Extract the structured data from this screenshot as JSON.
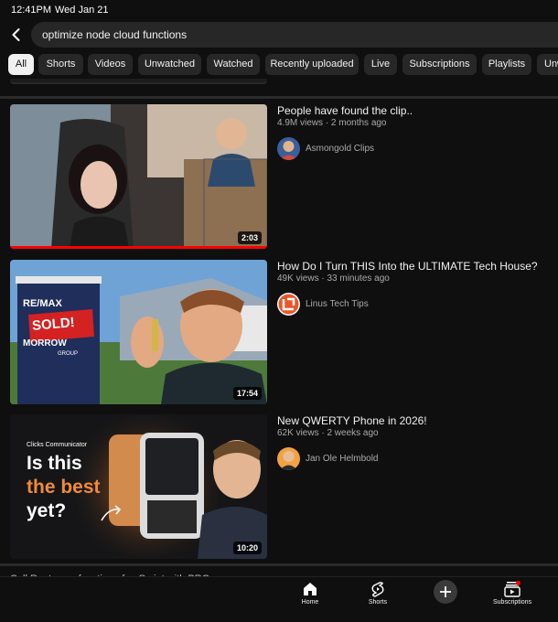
{
  "status": {
    "time": "12:41PM",
    "date": "Wed Jan 21"
  },
  "search": {
    "query": "optimize node cloud functions"
  },
  "chips": [
    {
      "label": "All",
      "active": true
    },
    {
      "label": "Shorts"
    },
    {
      "label": "Videos"
    },
    {
      "label": "Unwatched"
    },
    {
      "label": "Watched"
    },
    {
      "label": "Recently uploaded"
    },
    {
      "label": "Live"
    },
    {
      "label": "Subscriptions"
    },
    {
      "label": "Playlists"
    },
    {
      "label": "Unw"
    }
  ],
  "videos": [
    {
      "title": "People have found the clip..",
      "meta": "4.9M views · 2 months ago",
      "channel": "Asmongold Clips",
      "duration": "2:03",
      "watched_fraction": 1.0
    },
    {
      "title": "How Do I Turn THIS Into the ULTIMATE Tech House?",
      "meta": "49K views · 33 minutes ago",
      "channel": "Linus Tech Tips",
      "duration": "17:54",
      "thumb_text": {
        "brand": "RE/MAX",
        "sold": "SOLD!",
        "agency": "MORROW",
        "group": "GROUP"
      }
    },
    {
      "title": "New QWERTY Phone in 2026!",
      "meta": "62K views · 2 weeks ago",
      "channel": "Jan Ole Helmbold",
      "duration": "10:20",
      "thumb_text": {
        "small": "Clicks Communicator",
        "line1": "Is this",
        "line2": "the best",
        "line3": "yet?"
      }
    }
  ],
  "next_peek": "Cell Root sees function of ... Script with PRO",
  "nav": [
    {
      "label": "Home",
      "icon": "home-icon"
    },
    {
      "label": "Shorts",
      "icon": "shorts-icon"
    },
    {
      "label": "",
      "icon": "plus-icon"
    },
    {
      "label": "Subscriptions",
      "icon": "subscriptions-icon"
    }
  ],
  "colors": {
    "background": "#0f0f0f",
    "chip": "#272727",
    "accent": "#ff0000"
  }
}
